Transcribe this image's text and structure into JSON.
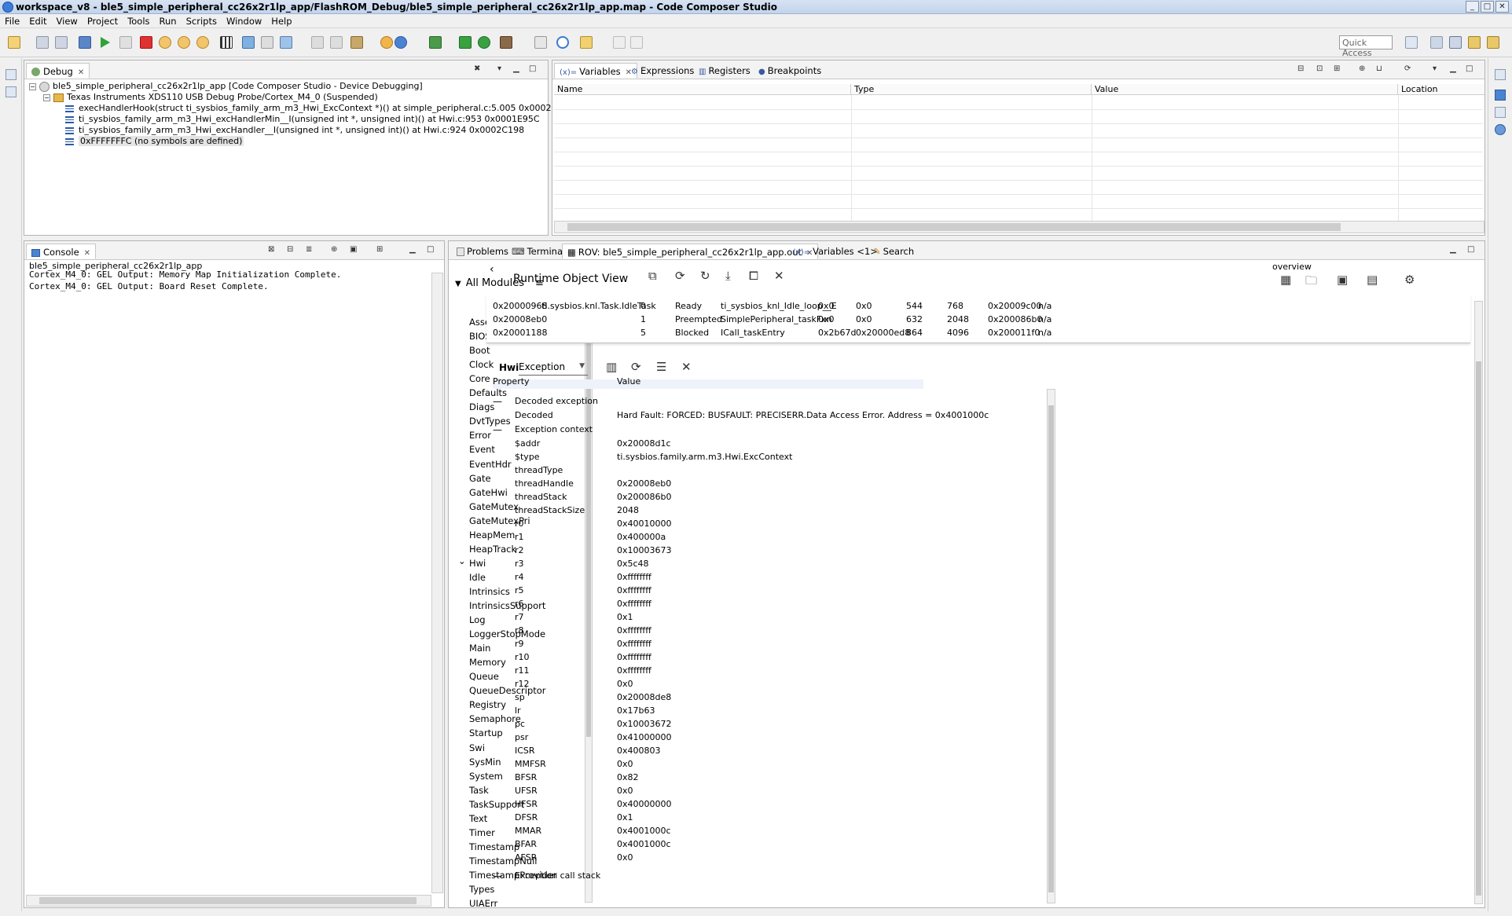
{
  "window": {
    "title": "workspace_v8 - ble5_simple_peripheral_cc26x2r1lp_app/FlashROM_Debug/ble5_simple_peripheral_cc26x2r1lp_app.map - Code Composer Studio"
  },
  "menu": [
    "File",
    "Edit",
    "View",
    "Project",
    "Tools",
    "Run",
    "Scripts",
    "Window",
    "Help"
  ],
  "toolbar": {
    "quick_access": "Quick Access"
  },
  "debug": {
    "tab": "Debug",
    "session": "ble5_simple_peripheral_cc26x2r1lp_app [Code Composer Studio - Device Debugging]",
    "probe": "Texas Instruments XDS110 USB Debug Probe/Cortex_M4_0 (Suspended)",
    "frames": [
      "execHandlerHook(struct ti_sysbios_family_arm_m3_Hwi_ExcContext *)() at simple_peripheral.c:5.005 0x0002BDBA",
      "ti_sysbios_family_arm_m3_Hwi_excHandlerMin__I(unsigned int *, unsigned int)() at Hwi.c:953 0x0001E95C",
      "ti_sysbios_family_arm_m3_Hwi_excHandler__I(unsigned int *, unsigned int)() at Hwi.c:924 0x0002C198",
      "0xFFFFFFFC  (no symbols are defined)"
    ]
  },
  "variables": {
    "tabs": [
      "Variables",
      "Expressions",
      "Registers",
      "Breakpoints"
    ],
    "columns": [
      "Name",
      "Type",
      "Value",
      "Location"
    ]
  },
  "console": {
    "tab": "Console",
    "title": "ble5_simple_peripheral_cc26x2r1lp_app",
    "lines": [
      "Cortex_M4_0: GEL Output: Memory Map Initialization Complete.",
      "Cortex_M4_0: GEL Output: Board Reset Complete."
    ]
  },
  "bottom_tabs": {
    "problems": "Problems",
    "terminal": "Terminal",
    "rov": "ROV: ble5_simple_peripheral_cc26x2r1lp_app.out",
    "variables1": "Variables <1>",
    "search": "Search"
  },
  "rov": {
    "title": "Runtime Object View",
    "overview": "overview",
    "all_modules": "All Modules",
    "modules": [
      "Assert",
      "BIOS",
      "Boot",
      "Clock",
      "Core",
      "Defaults",
      "Diags",
      "DvtTypes",
      "Error",
      "Event",
      "EventHdr",
      "Gate",
      "GateHwi",
      "GateMutex",
      "GateMutexPri",
      "HeapMem",
      "HeapTrack",
      "Hwi",
      "Idle",
      "Intrinsics",
      "IntrinsicsSupport",
      "Log",
      "LoggerStopMode",
      "Main",
      "Memory",
      "Queue",
      "QueueDescriptor",
      "Registry",
      "Semaphore",
      "Startup",
      "Swi",
      "SysMin",
      "System",
      "Task",
      "TaskSupport",
      "Text",
      "Timer",
      "Timestamp",
      "TimestampNull",
      "TimestampProvider",
      "Types",
      "UIAErr"
    ],
    "task_rows": [
      [
        "0x20000968",
        "ti.sysbios.knl.Task.IdleTask",
        "0",
        "Ready",
        "ti_sysbios_knl_Idle_loop__E",
        "0x0",
        "0x0",
        "544",
        "768",
        "0x20009c00",
        "n/a"
      ],
      [
        "0x20008eb0",
        "",
        "1",
        "Preempted",
        "SimplePeripheral_taskFxn",
        "0x0",
        "0x0",
        "632",
        "2048",
        "0x200086b0",
        "n/a"
      ],
      [
        "0x20001188",
        "",
        "5",
        "Blocked",
        "ICall_taskEntry",
        "0x2b67d",
        "0x20000ed8",
        "864",
        "4096",
        "0x200011f0",
        "n/a"
      ]
    ],
    "hwi_label": "Hwi",
    "hwi_view": "Exception",
    "prop_header": "Property",
    "value_header": "Value",
    "decoded_exception": "Decoded exception",
    "decoded_label": "Decoded",
    "decoded_value": "Hard Fault: FORCED: BUSFAULT: PRECISERR.Data Access Error. Address = 0x4001000c",
    "exception_context": "Exception context",
    "context": [
      [
        "$addr",
        "0x20008d1c"
      ],
      [
        "$type",
        "ti.sysbios.family.arm.m3.Hwi.ExcContext"
      ],
      [
        "threadType",
        ""
      ],
      [
        "threadHandle",
        "0x20008eb0"
      ],
      [
        "threadStack",
        "0x200086b0"
      ],
      [
        "threadStackSize",
        "2048"
      ],
      [
        "r0",
        "0x40010000"
      ],
      [
        "r1",
        "0x400000a"
      ],
      [
        "r2",
        "0x10003673"
      ],
      [
        "r3",
        "0x5c48"
      ],
      [
        "r4",
        "0xffffffff"
      ],
      [
        "r5",
        "0xffffffff"
      ],
      [
        "r6",
        "0xffffffff"
      ],
      [
        "r7",
        "0x1"
      ],
      [
        "r8",
        "0xffffffff"
      ],
      [
        "r9",
        "0xffffffff"
      ],
      [
        "r10",
        "0xffffffff"
      ],
      [
        "r11",
        "0xffffffff"
      ],
      [
        "r12",
        "0x0"
      ],
      [
        "sp",
        "0x20008de8"
      ],
      [
        "lr",
        "0x17b63"
      ],
      [
        "pc",
        "0x10003672"
      ],
      [
        "psr",
        "0x41000000"
      ],
      [
        "ICSR",
        "0x400803"
      ],
      [
        "MMFSR",
        "0x0"
      ],
      [
        "BFSR",
        "0x82"
      ],
      [
        "UFSR",
        "0x0"
      ],
      [
        "HFSR",
        "0x40000000"
      ],
      [
        "DFSR",
        "0x1"
      ],
      [
        "MMAR",
        "0x4001000c"
      ],
      [
        "BFAR",
        "0x4001000c"
      ],
      [
        "AFSR",
        "0x0"
      ]
    ],
    "call_stack": "Exception call stack"
  }
}
